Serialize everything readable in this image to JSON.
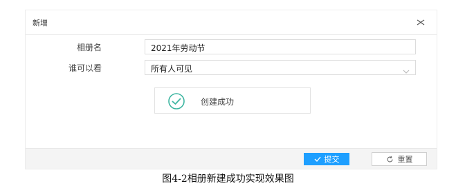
{
  "dialog": {
    "title": "新增",
    "close_icon": "close-icon"
  },
  "form": {
    "album_name_label": "相册名",
    "album_name_value": "2021年劳动节",
    "visibility_label": "谁可以看",
    "visibility_value": "所有人可见"
  },
  "toast": {
    "icon": "check-circle-icon",
    "message": "创建成功"
  },
  "footer": {
    "submit_label": "提交",
    "reset_label": "重置"
  },
  "caption": "图4-2相册新建成功实现效果图",
  "colors": {
    "accent": "#1e9fff",
    "success": "#3cb5a0"
  }
}
